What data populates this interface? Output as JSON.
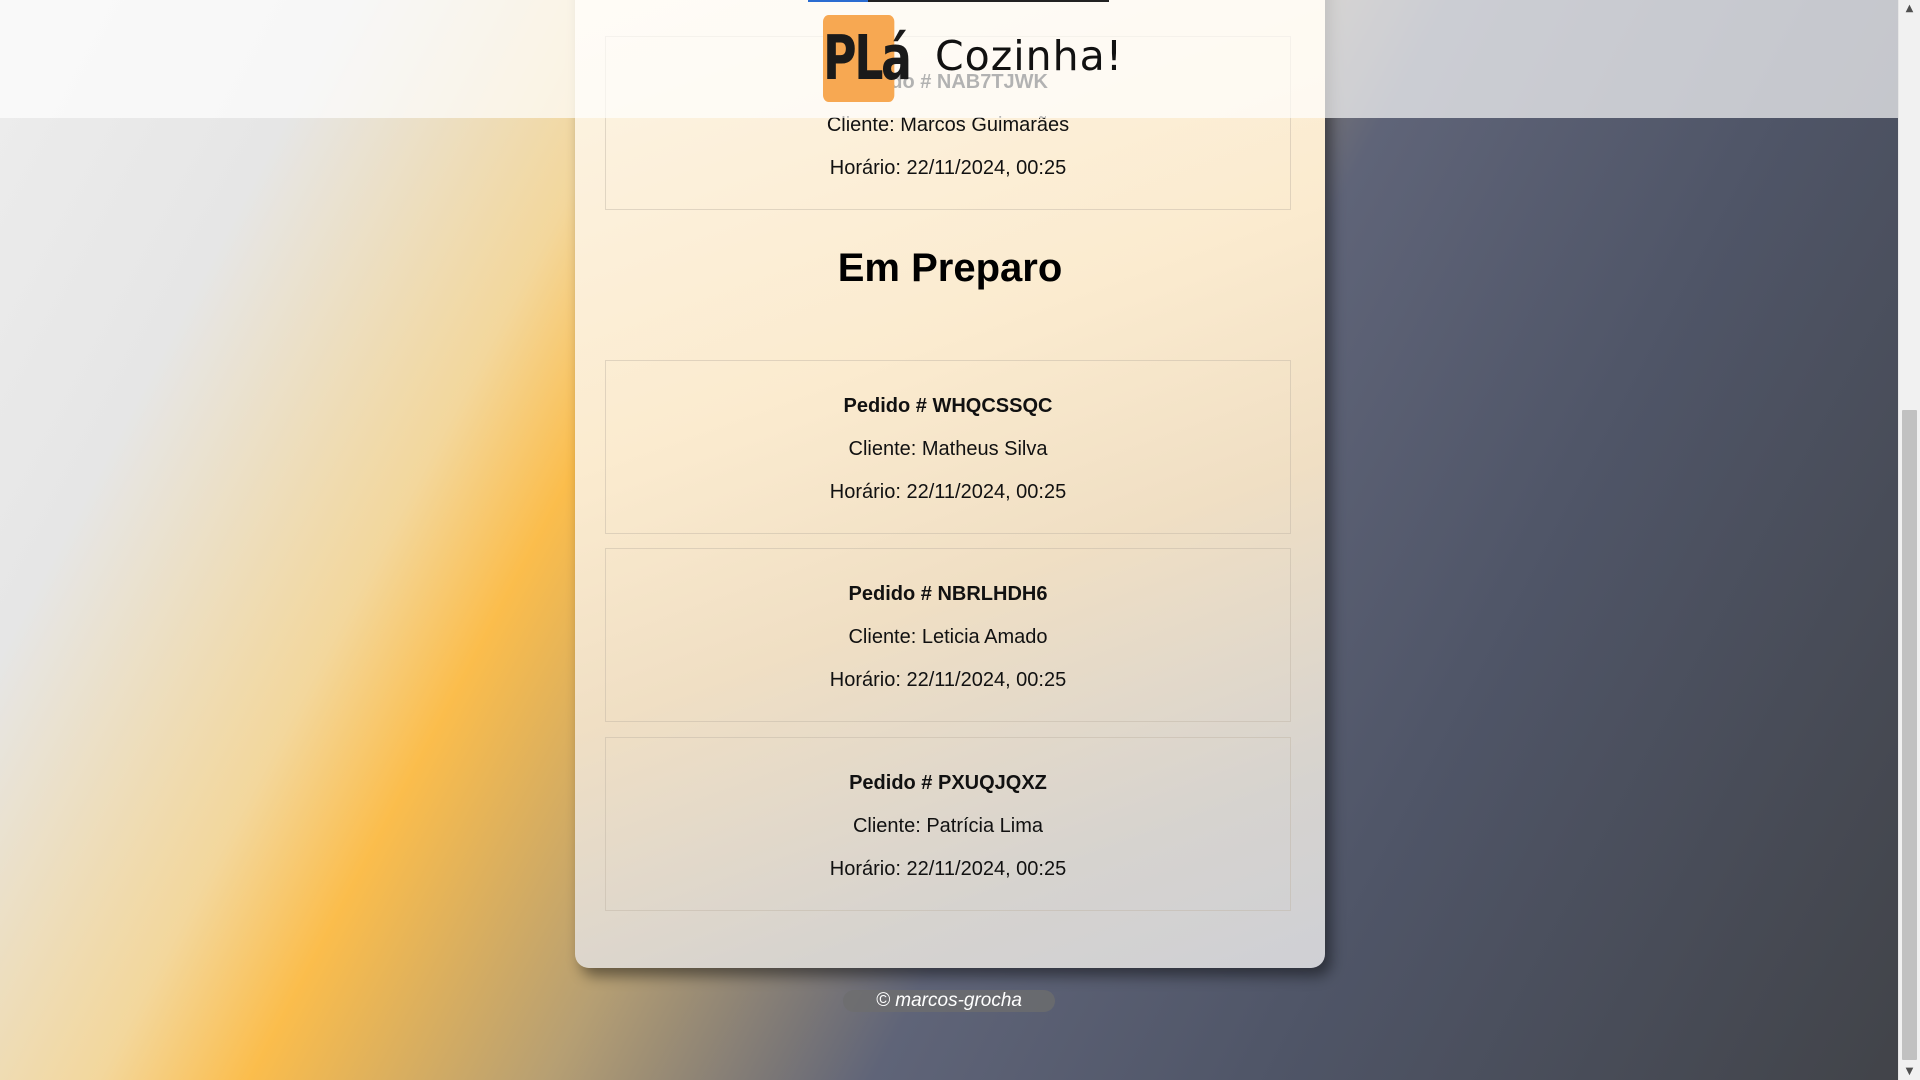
{
  "header": {
    "logo_text": "PLá",
    "title": "Cozinha!"
  },
  "partial_order": {
    "id": "Pedido # NAB7TJWK",
    "client": "Cliente: Marcos Guimarães",
    "time": "Horário: 22/11/2024, 00:25"
  },
  "in_progress": {
    "title": "Em Preparo",
    "orders": [
      {
        "id": "Pedido # WHQCSSQC",
        "client": "Cliente: Matheus Silva",
        "time": "Horário: 22/11/2024, 00:25"
      },
      {
        "id": "Pedido # NBRLHDH6",
        "client": "Cliente: Leticia Amado",
        "time": "Horário: 22/11/2024, 00:25"
      },
      {
        "id": "Pedido # PXUQJQXZ",
        "client": "Cliente: Patrícia Lima",
        "time": "Horário: 22/11/2024, 00:25"
      }
    ]
  },
  "footer": {
    "text": "© marcos-grocha"
  },
  "colors": {
    "logo_bg": "#f7a852",
    "accent_line": "#2a6cd1"
  },
  "icons": {
    "scroll_up": "chevron-up-icon",
    "scroll_down": "chevron-down-icon"
  }
}
